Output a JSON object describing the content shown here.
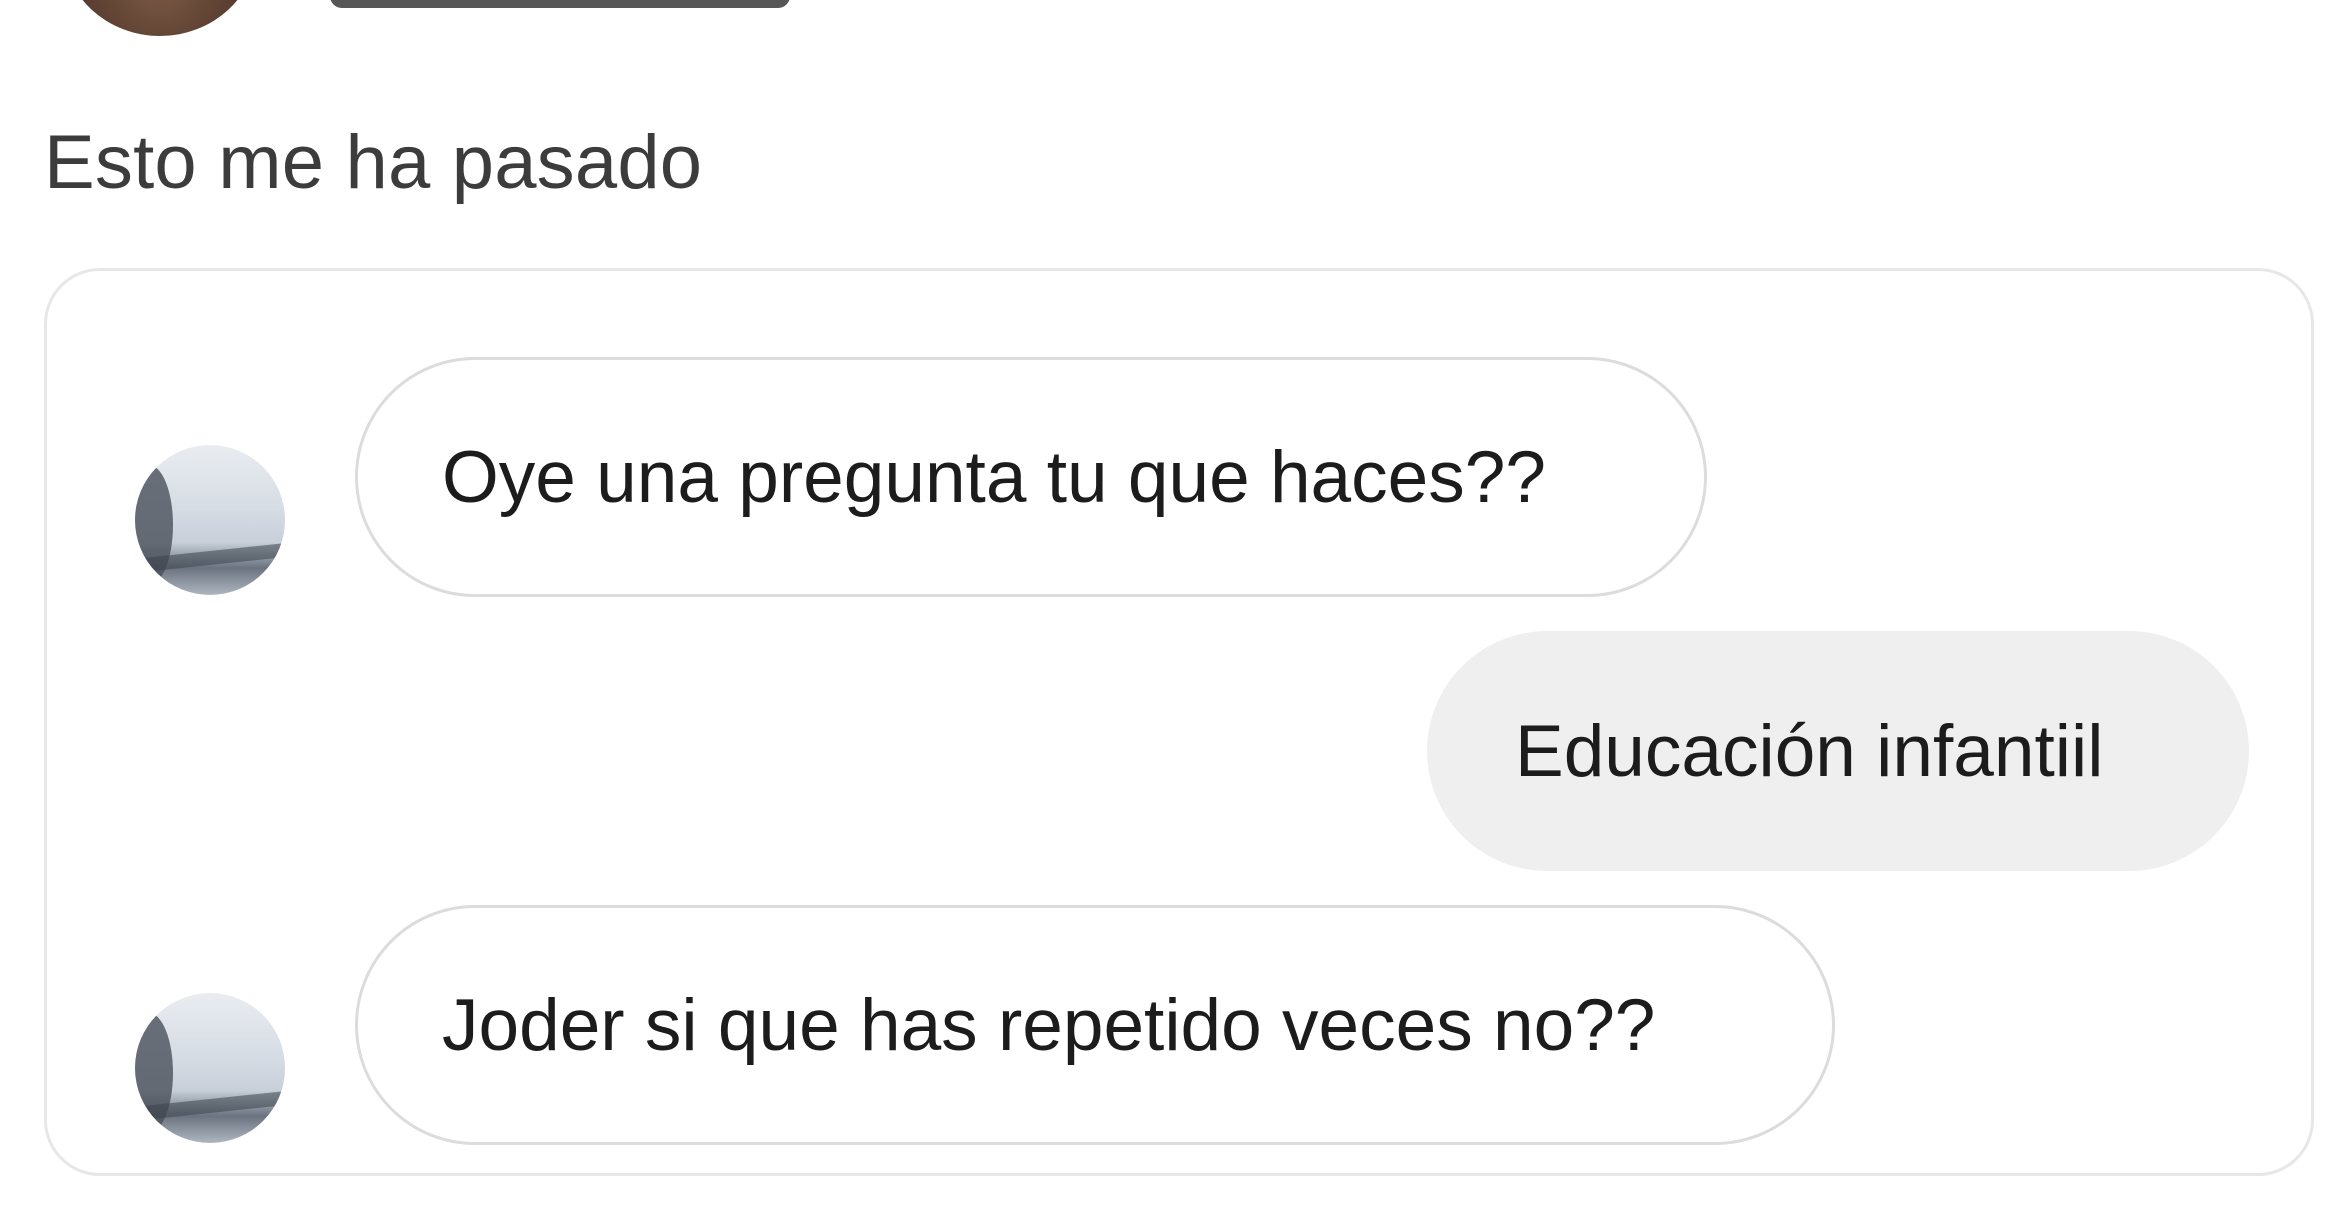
{
  "post": {
    "caption": "Esto me ha pasado"
  },
  "conversation": {
    "messages": [
      {
        "sender": "other",
        "text": "Oye una pregunta tu que haces??"
      },
      {
        "sender": "me",
        "text": "Educación infantiil"
      },
      {
        "sender": "other",
        "text": "Joder si que has repetido veces no??"
      }
    ]
  },
  "colors": {
    "incoming_bubble_border": "#dcdcdc",
    "outgoing_bubble_bg": "#efefef",
    "card_border": "#e7e7e7"
  }
}
